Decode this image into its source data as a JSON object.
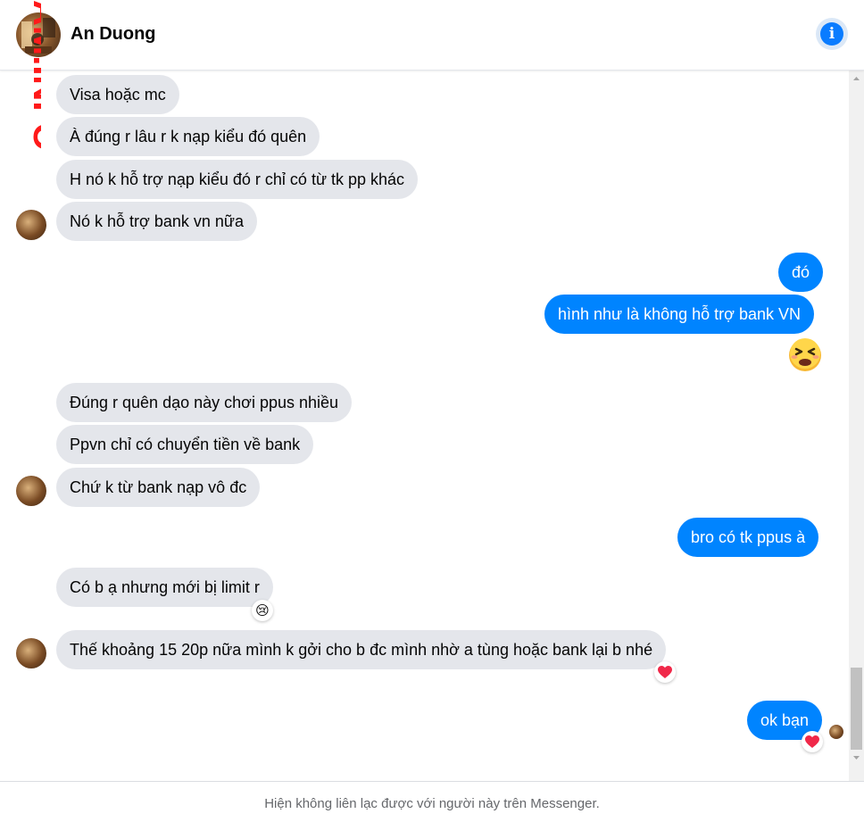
{
  "header": {
    "contact_name": "An Duong",
    "watermark": "AM.INFO",
    "info_icon": "info-icon"
  },
  "messages": [
    {
      "id": "m1",
      "side": "in",
      "text": "Visa hoặc mc"
    },
    {
      "id": "m2",
      "side": "in",
      "text": "À đúng r lâu r k nạp kiểu đó quên"
    },
    {
      "id": "m3",
      "side": "in",
      "text": "H nó k hỗ trợ nạp kiểu đó r chỉ có từ tk pp khác"
    },
    {
      "id": "m4",
      "side": "in",
      "text": "Nó k hỗ trợ bank vn nữa"
    },
    {
      "id": "m5",
      "side": "out",
      "text": "đó"
    },
    {
      "id": "m6",
      "side": "out",
      "text": "hình như là không hỗ trợ bank VN"
    },
    {
      "id": "m7",
      "side": "out",
      "emoji": "persevering-face"
    },
    {
      "id": "m8",
      "side": "in",
      "text": "Đúng r quên dạo này chơi ppus nhiều"
    },
    {
      "id": "m9",
      "side": "in",
      "text": "Ppvn chỉ có chuyển tiền về bank"
    },
    {
      "id": "m10",
      "side": "in",
      "text": "Chứ k từ bank nạp vô đc"
    },
    {
      "id": "m11",
      "side": "out",
      "text": "bro có tk ppus à"
    },
    {
      "id": "m12",
      "side": "in",
      "text": "Có b ạ nhưng mới bị limit r",
      "reaction": "😢"
    },
    {
      "id": "m13",
      "side": "in",
      "text": "Thế khoảng 15 20p nữa mình k gởi cho b đc mình nhờ a tùng hoặc bank lại b nhé",
      "reaction": "❤️"
    },
    {
      "id": "m14",
      "side": "out",
      "text": "ok bạn",
      "reaction": "❤️"
    }
  ],
  "footer": {
    "notice": "Hiện không liên lạc được với người này trên Messenger."
  },
  "colors": {
    "outgoing_bubble": "#0084ff",
    "incoming_bubble": "#e4e6eb",
    "heart": "#f02849",
    "watermark": "#ff1a1a"
  }
}
